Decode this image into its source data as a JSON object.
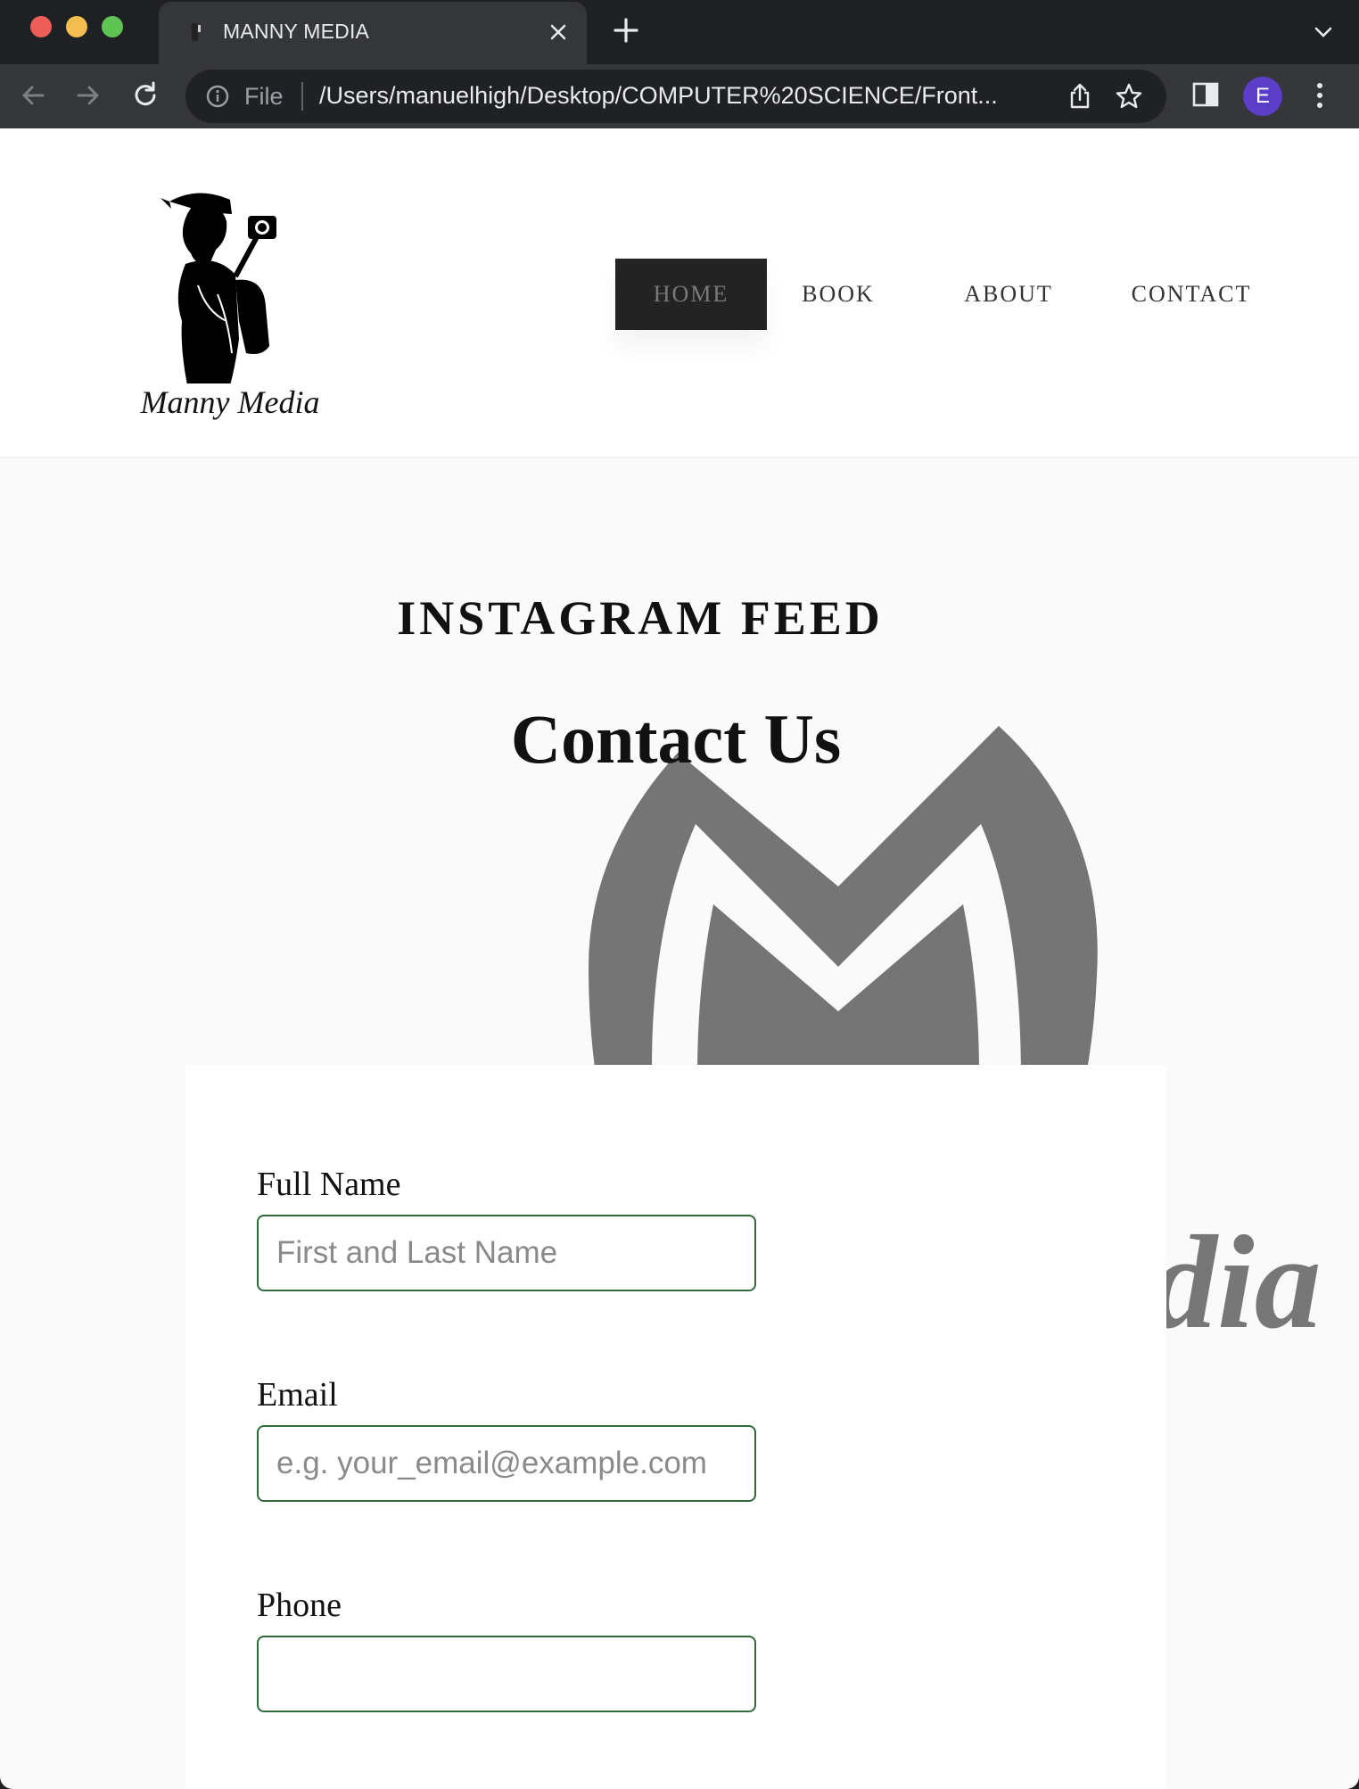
{
  "browser": {
    "tab_title": "MANNY MEDIA",
    "omnibox_scheme": "File",
    "url": "/Users/manuelhigh/Desktop/COMPUTER%20SCIENCE/Front...",
    "profile_initial": "E",
    "icons": {
      "back": "arrow-left-icon",
      "forward": "arrow-right-icon",
      "reload": "reload-icon",
      "info": "info-icon",
      "share": "share-icon",
      "bookmark": "star-icon",
      "side_panel": "side-panel-icon",
      "menu": "kebab-menu-icon",
      "new_tab": "plus-icon",
      "close_tab": "close-icon",
      "tab_search": "chevron-down-icon"
    },
    "colors": {
      "frame": "#1f2023",
      "toolbar": "#35363a",
      "omnibox": "#202124",
      "avatar": "#5b3ec8"
    }
  },
  "site": {
    "logo_text": "Manny Media",
    "nav": [
      {
        "label": "HOME",
        "active": true
      },
      {
        "label": "BOOK",
        "active": false
      },
      {
        "label": "ABOUT",
        "active": false
      },
      {
        "label": "CONTACT",
        "active": false
      }
    ],
    "instagram_title": "INSTAGRAM FEED",
    "contact_title": "Contact Us",
    "background_brand_fragment": "dia",
    "form": {
      "full_name": {
        "label": "Full Name",
        "placeholder": "First and Last Name",
        "value": ""
      },
      "email": {
        "label": "Email",
        "placeholder": "e.g. your_email@example.com",
        "value": ""
      },
      "phone": {
        "label": "Phone",
        "placeholder": "",
        "value": ""
      }
    },
    "colors": {
      "nav_active_bg": "#232323",
      "input_border": "#2e6b3e",
      "page_bg": "#fafafa"
    }
  }
}
